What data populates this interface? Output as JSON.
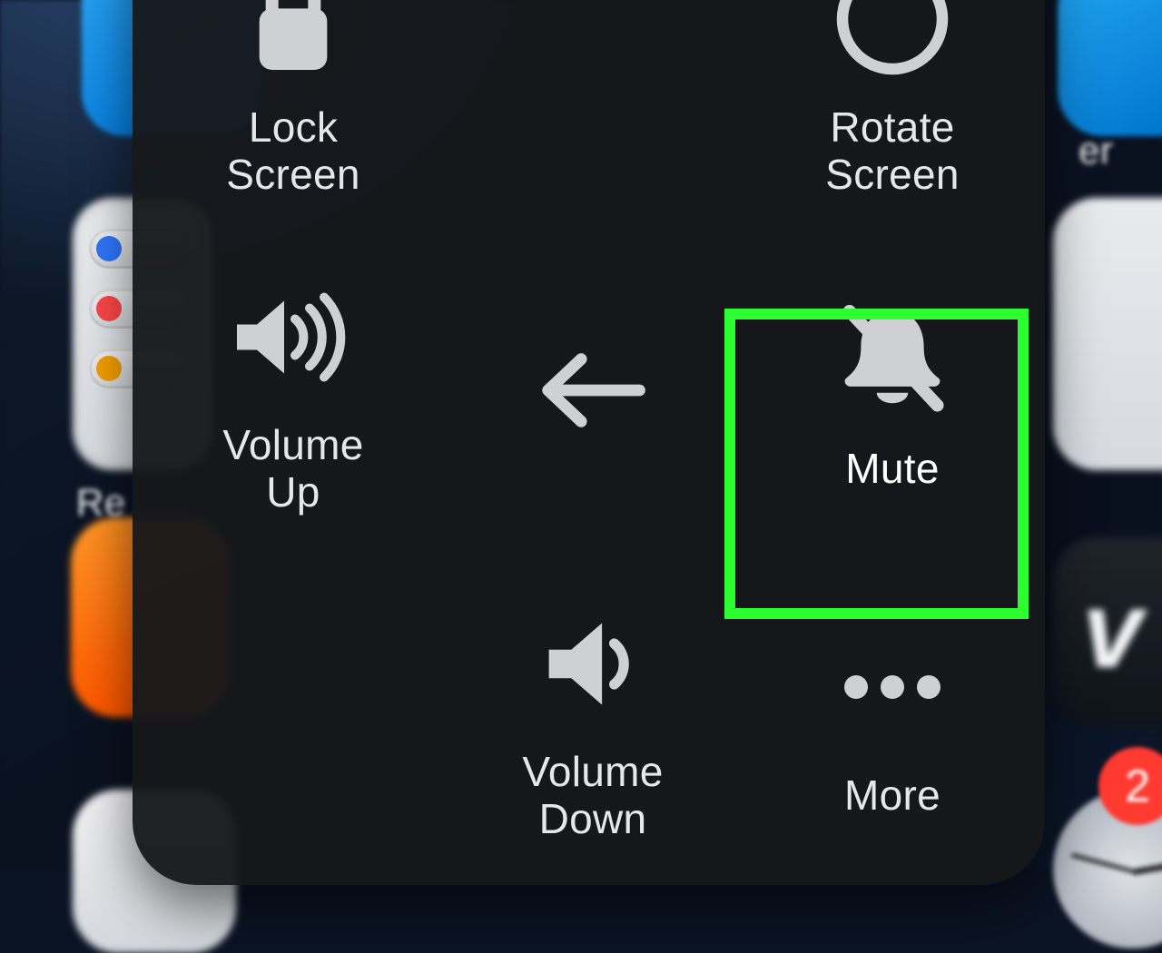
{
  "bg_labels": {
    "re": "Re",
    "er": "er"
  },
  "badge_count": "2",
  "menu": {
    "lock_screen": {
      "label": "Lock\nScreen"
    },
    "rotate_screen": {
      "label": "Rotate\nScreen"
    },
    "volume_up": {
      "label": "Volume\nUp"
    },
    "mute": {
      "label": "Mute"
    },
    "volume_down": {
      "label": "Volume\nDown"
    },
    "more": {
      "label": "More"
    }
  },
  "highlight": "mute"
}
